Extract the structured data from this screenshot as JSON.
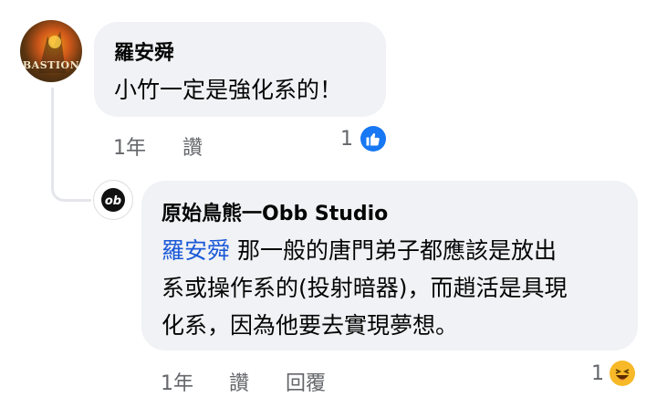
{
  "comments": [
    {
      "author": "羅安舜",
      "text": "小竹一定是強化系的！",
      "time": "1年",
      "action_like": "讚",
      "reaction_count": "1",
      "reaction_icon": "like-icon",
      "avatar_label": "BASTION"
    },
    {
      "author": "原始鳥熊一Obb Studio",
      "mention": "羅安舜",
      "text_line1": " 那一般的唐門弟子都應該是放出",
      "text_line2": "系或操作系的(投射暗器)，而趙活是具現",
      "text_line3": "化系，因為他要去實現夢想。",
      "time": "1年",
      "action_like": "讚",
      "action_reply": "回覆",
      "reaction_count": "1",
      "reaction_icon": "haha-icon"
    }
  ],
  "colors": {
    "bubble": "#f0f2f5",
    "mention": "#1b59d8",
    "like_blue": "#1877f2",
    "haha_yellow": "#f7b928"
  }
}
